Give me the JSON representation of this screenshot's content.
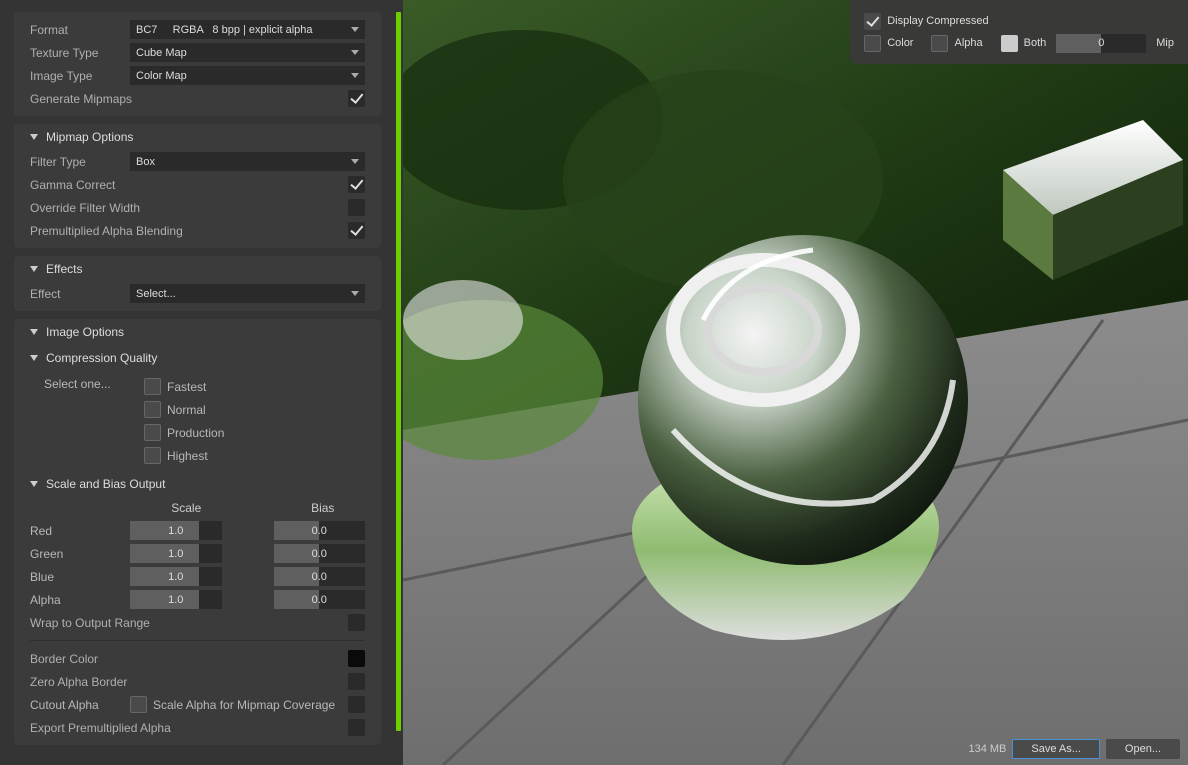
{
  "props": {
    "format_label": "Format",
    "format_value": "BC7     RGBA   8 bpp | explicit alpha",
    "texture_type_label": "Texture Type",
    "texture_type_value": "Cube Map",
    "image_type_label": "Image Type",
    "image_type_value": "Color Map",
    "generate_mipmaps_label": "Generate Mipmaps"
  },
  "mipmap": {
    "header": "Mipmap Options",
    "filter_type_label": "Filter Type",
    "filter_type_value": "Box",
    "gamma_correct_label": "Gamma Correct",
    "override_filter_width_label": "Override Filter Width",
    "premult_label": "Premultiplied Alpha Blending"
  },
  "effects": {
    "header": "Effects",
    "effect_label": "Effect",
    "effect_value": "Select..."
  },
  "image_options": {
    "header": "Image Options"
  },
  "compression": {
    "header": "Compression Quality",
    "prompt": "Select one...",
    "options": [
      "Fastest",
      "Normal",
      "Production",
      "Highest"
    ]
  },
  "scale_bias": {
    "header": "Scale and Bias Output",
    "scale_col": "Scale",
    "bias_col": "Bias",
    "channels": [
      {
        "label": "Red",
        "scale": "1.0",
        "bias": "0.0"
      },
      {
        "label": "Green",
        "scale": "1.0",
        "bias": "0.0"
      },
      {
        "label": "Blue",
        "scale": "1.0",
        "bias": "0.0"
      },
      {
        "label": "Alpha",
        "scale": "1.0",
        "bias": "0.0"
      }
    ],
    "wrap_label": "Wrap to Output Range"
  },
  "misc": {
    "border_color_label": "Border Color",
    "zero_alpha_label": "Zero Alpha Border",
    "cutout_alpha_label": "Cutout Alpha",
    "scale_alpha_label": "Scale Alpha for Mipmap Coverage",
    "export_premult_label": "Export Premultiplied Alpha"
  },
  "overlay": {
    "display_compressed": "Display Compressed",
    "color": "Color",
    "alpha": "Alpha",
    "both": "Both",
    "mip_value": "0",
    "mip_label": "Mip"
  },
  "bottom": {
    "size": "134 MB",
    "save": "Save As...",
    "open": "Open..."
  }
}
